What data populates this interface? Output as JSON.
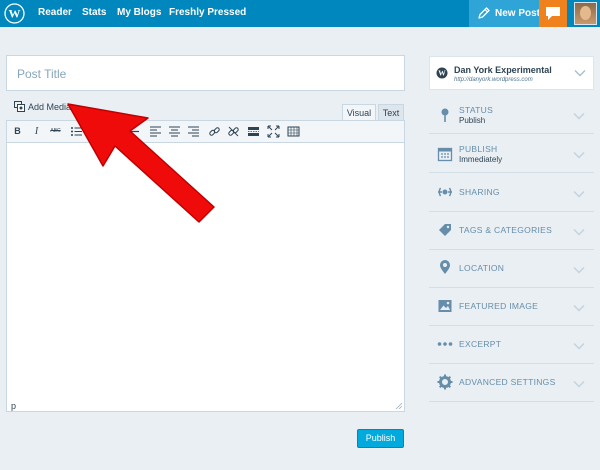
{
  "topbar": {
    "logo_icon": "wordpress-logo-icon",
    "nav": [
      "Reader",
      "Stats",
      "My Blogs",
      "Freshly Pressed"
    ],
    "new_post_label": "New Post",
    "notification_icon": "notifications-icon",
    "colors": {
      "bar": "#0087be",
      "new_post": "#2fa4d6",
      "notifications": "#f0821e"
    }
  },
  "editor": {
    "title_placeholder": "Post Title",
    "add_media_label": "Add Media",
    "tabs": [
      "Visual",
      "Text"
    ],
    "active_tab": "Visual",
    "toolbar_icons": [
      "bold-icon",
      "italic-icon",
      "strikethrough-icon",
      "bulleted-list-icon",
      "numbered-list-icon",
      "blockquote-icon",
      "horizontal-line-icon",
      "align-left-icon",
      "align-center-icon",
      "align-right-icon",
      "insert-link-icon",
      "remove-link-icon",
      "read-more-icon",
      "fullscreen-icon",
      "toolbar-toggle-icon"
    ],
    "toolbar_bold": "B",
    "toolbar_italic": "I",
    "toolbar_strike": "ABC",
    "status_path": "p"
  },
  "publish_button": "Publish",
  "sidebar": {
    "site_name": "Dan York Experimental",
    "site_url": "http://danyork.wordpress.com",
    "items": [
      {
        "label": "STATUS",
        "value": "Publish",
        "icon": "pin-icon"
      },
      {
        "label": "PUBLISH",
        "value": "Immediately",
        "icon": "calendar-icon"
      },
      {
        "label": "SHARING",
        "value": "",
        "icon": "sharing-icon"
      },
      {
        "label": "TAGS & CATEGORIES",
        "value": "",
        "icon": "tag-icon"
      },
      {
        "label": "LOCATION",
        "value": "",
        "icon": "location-icon"
      },
      {
        "label": "FEATURED IMAGE",
        "value": "",
        "icon": "image-icon"
      },
      {
        "label": "EXCERPT",
        "value": "",
        "icon": "ellipsis-icon"
      },
      {
        "label": "ADVANCED SETTINGS",
        "value": "",
        "icon": "gear-icon"
      }
    ]
  },
  "annotation": {
    "type": "red-arrow",
    "points_to": "Add Media",
    "color": "#f00b0b"
  }
}
